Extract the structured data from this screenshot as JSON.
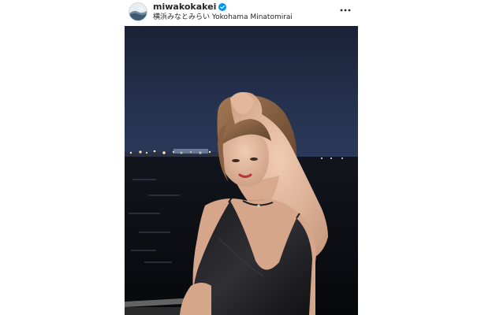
{
  "post": {
    "username": "miwakokakei",
    "location": "横浜みなとみらい Yokohama Minatomirai",
    "verified": true,
    "more_options_icon": "ellipsis-horizontal-icon",
    "verified_icon": "verified-badge-icon",
    "avatar_icon": "profile-avatar"
  },
  "colors": {
    "text": "#262626",
    "verified_blue": "#0095f6",
    "night_sky": "#1f2a44",
    "water": "#0b0d12"
  }
}
